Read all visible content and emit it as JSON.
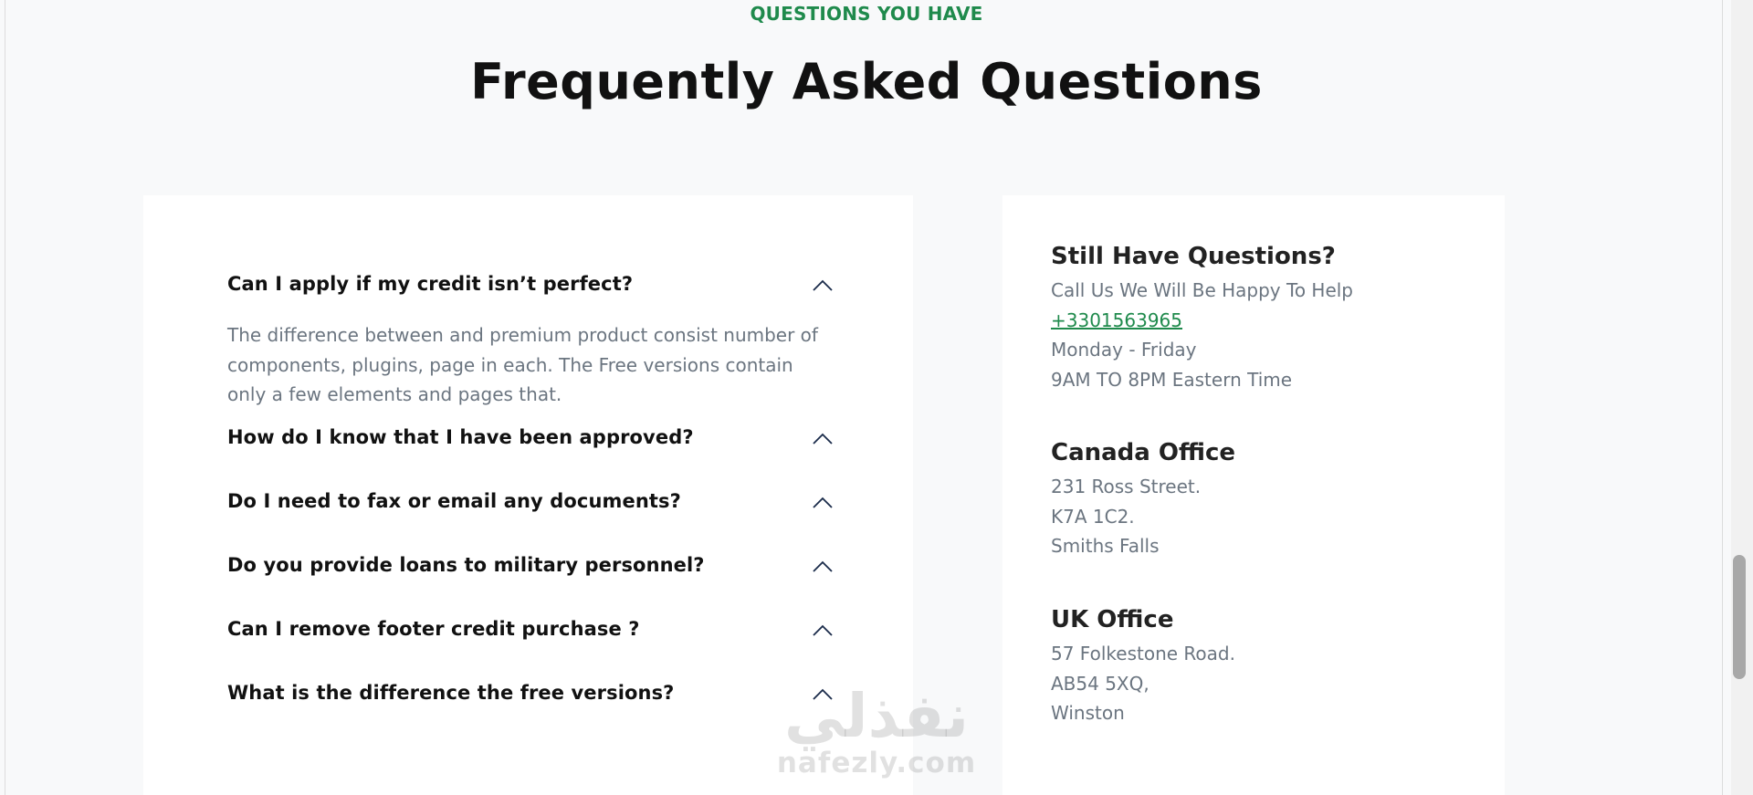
{
  "section": {
    "eyebrow": "QUESTIONS YOU HAVE",
    "title": "Frequently Asked Questions",
    "accent_color": "#1f8a4c"
  },
  "faq": {
    "items": [
      {
        "question": "Can I apply if my credit isn’t perfect?",
        "expanded": true,
        "answer_lines": [
          "The difference between and premium product consist number of",
          "components, plugins, page in each. The Free versions contain",
          "only a few elements and pages that."
        ]
      },
      {
        "question": "How do I know that I have been approved?",
        "expanded": false
      },
      {
        "question": "Do I need to fax or email any documents?",
        "expanded": false
      },
      {
        "question": "Do you provide loans to military personnel?",
        "expanded": false
      },
      {
        "question": "Can I remove footer credit purchase ?",
        "expanded": false
      },
      {
        "question": "What is the difference the free versions?",
        "expanded": false
      }
    ],
    "toggle_icon": "chevron-up-icon"
  },
  "contact": {
    "help": {
      "heading": "Still Have Questions?",
      "subtitle": "Call Us We Will Be Happy To Help",
      "phone": "+3301563965",
      "days": "Monday - Friday",
      "hours": "9AM TO 8PM Eastern Time"
    },
    "canada": {
      "heading": "Canada Office",
      "lines": [
        "231 Ross Street.",
        "K7A 1C2.",
        "Smiths Falls"
      ]
    },
    "uk": {
      "heading": "UK Office",
      "lines": [
        "57 Folkestone Road.",
        "AB54 5XQ,",
        "Winston"
      ]
    }
  },
  "watermark": {
    "arabic": "نفذلي",
    "latin": "nafezly.com"
  }
}
